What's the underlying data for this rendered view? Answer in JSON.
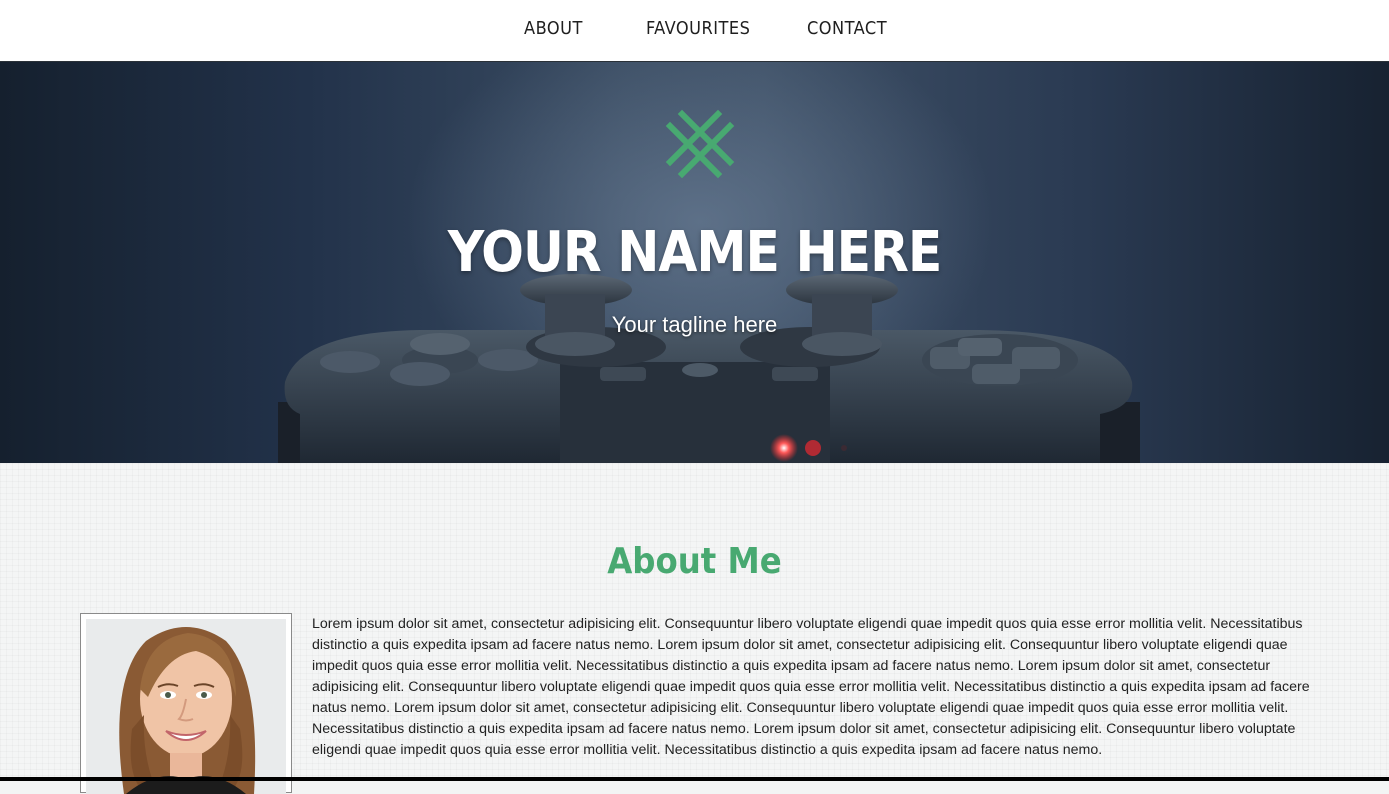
{
  "nav": {
    "items": [
      {
        "label": "ABOUT"
      },
      {
        "label": "FAVOURITES"
      },
      {
        "label": "CONTACT"
      }
    ]
  },
  "hero": {
    "title": "YOUR NAME HERE",
    "tagline": "Your tagline here",
    "logo_icon": "crosshatch-logo-icon",
    "background_image": "game-controller-photo"
  },
  "about": {
    "heading": "About Me",
    "photo": "profile-photo",
    "body": "Lorem ipsum dolor sit amet, consectetur adipisicing elit. Consequuntur libero voluptate eligendi quae impedit quos quia esse error mollitia velit. Necessitatibus distinctio a quis expedita ipsam ad facere natus nemo. Lorem ipsum dolor sit amet, consectetur adipisicing elit. Consequuntur libero voluptate eligendi quae impedit quos quia esse error mollitia velit. Necessitatibus distinctio a quis expedita ipsam ad facere natus nemo. Lorem ipsum dolor sit amet, consectetur adipisicing elit. Consequuntur libero voluptate eligendi quae impedit quos quia esse error mollitia velit. Necessitatibus distinctio a quis expedita ipsam ad facere natus nemo. Lorem ipsum dolor sit amet, consectetur adipisicing elit. Consequuntur libero voluptate eligendi quae impedit quos quia esse error mollitia velit. Necessitatibus distinctio a quis expedita ipsam ad facere natus nemo. Lorem ipsum dolor sit amet, consectetur adipisicing elit. Consequuntur libero voluptate eligendi quae impedit quos quia esse error mollitia velit. Necessitatibus distinctio a quis expedita ipsam ad facere natus nemo."
  },
  "colors": {
    "accent": "#48a971",
    "nav_bg": "#ffffff",
    "nav_text": "#1f1f1f",
    "hero_text": "#ffffff",
    "body_text": "#222222"
  }
}
